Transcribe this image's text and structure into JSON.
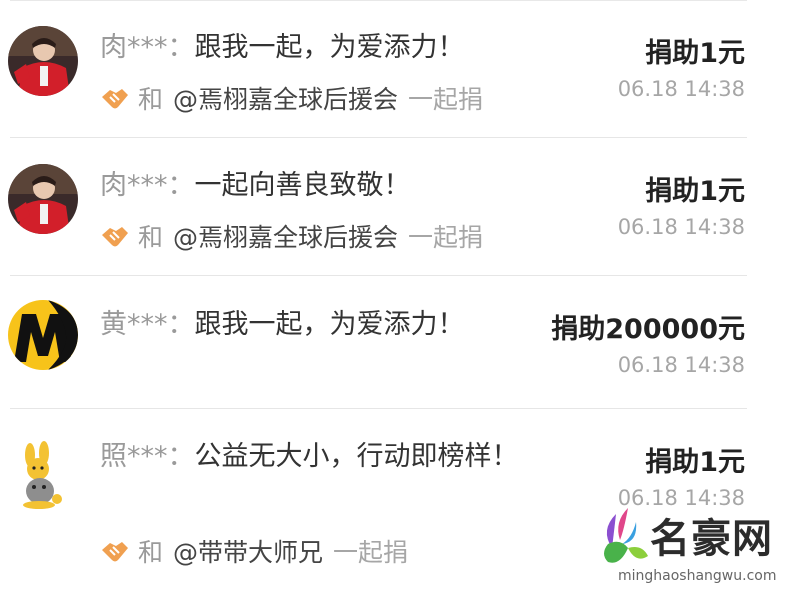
{
  "donations": [
    {
      "donor": "肉***",
      "colon": "：",
      "message": "跟我一起，为爱添力！",
      "amount": "捐助1元",
      "time": "06.18 14:38",
      "join_prefix": "和",
      "team": "@焉栩嘉全球后援会",
      "join_suffix": "一起捐",
      "avatar": "red-jacket-person-avatar"
    },
    {
      "donor": "肉***",
      "colon": "：",
      "message": "一起向善良致敬！",
      "amount": "捐助1元",
      "time": "06.18 14:38",
      "join_prefix": "和",
      "team": "@焉栩嘉全球后援会",
      "join_suffix": "一起捐",
      "avatar": "red-jacket-person-avatar"
    },
    {
      "donor": "黄***",
      "colon": "：",
      "message": "跟我一起，为爱添力！",
      "amount": "捐助200000元",
      "time": "06.18 14:38",
      "avatar": "yellow-black-logo-avatar"
    },
    {
      "donor": "照***",
      "colon": "：",
      "message": "公益无大小，行动即榜样！",
      "amount": "捐助1元",
      "time": "06.18 14:38",
      "join_prefix": "和",
      "team": "@带带大师兄",
      "join_suffix": "一起捐",
      "avatar": "cartoon-rabbit-avatar"
    }
  ],
  "watermark": {
    "title": "名豪网",
    "url": "minghaoshangwu.com"
  },
  "colors": {
    "donor_name": "#9a9a9a",
    "amount": "#222222",
    "time": "#a6a6a6",
    "hand_icon": "#f0a050",
    "divider": "#e6e6e6"
  }
}
